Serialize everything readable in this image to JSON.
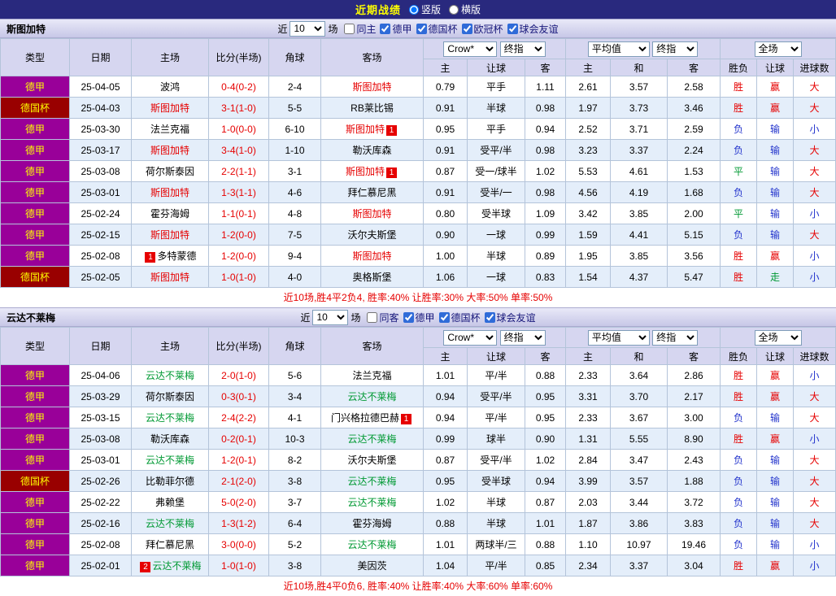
{
  "header": {
    "title": "近期战绩",
    "layout_options": [
      {
        "label": "竖版",
        "selected": true
      },
      {
        "label": "横版",
        "selected": false
      }
    ]
  },
  "colors": {
    "win": "#e60000",
    "draw": "#009933",
    "lose": "#2233cc",
    "score": "#e60000",
    "focus_team_section1": "#e60000",
    "focus_team_section2": "#009933",
    "league_dejia_bg": "#990099",
    "league_deguobei_bg": "#990000",
    "league_text": "#ffff00",
    "card_badge_bg": "#e60000"
  },
  "result_color_class": {
    "胜": "win",
    "平": "draw",
    "负": "lose",
    "赢": "win",
    "走": "draw",
    "输": "lose",
    "大": "win",
    "小": "lose"
  },
  "sections": [
    {
      "team": "斯图加特",
      "focus_color_key": "focus_team_section1",
      "filter": {
        "prefix": "近",
        "count": "10",
        "suffix": "场",
        "checkboxes": [
          {
            "label": "同主",
            "checked": false
          },
          {
            "label": "德甲",
            "checked": true
          },
          {
            "label": "德国杯",
            "checked": true
          },
          {
            "label": "欧冠杯",
            "checked": true
          },
          {
            "label": "球会友谊",
            "checked": true
          }
        ]
      },
      "table": {
        "static_headers": [
          "类型",
          "日期",
          "主场",
          "比分(半场)",
          "角球",
          "客场"
        ],
        "bookmaker_select": "Crow*",
        "bookmaker_odds_select": "终指",
        "avg_select": "平均值",
        "avg_odds_select": "终指",
        "scope_select": "全场",
        "odds_subheaders": [
          "主",
          "让球",
          "客"
        ],
        "avg_subheaders": [
          "主",
          "和",
          "客"
        ],
        "result_subheaders": [
          "胜负",
          "让球",
          "进球数"
        ],
        "rows": [
          {
            "league": "德甲",
            "date": "25-04-05",
            "home": "波鸿",
            "home_focus": false,
            "home_card": "",
            "score": "0-4(0-2)",
            "corner": "2-4",
            "away": "斯图加特",
            "away_focus": true,
            "away_card": "",
            "o1": "0.79",
            "hc": "平手",
            "o2": "1.11",
            "a1": "2.61",
            "a2": "3.57",
            "a3": "2.58",
            "res": "胜",
            "hres": "赢",
            "goal": "大"
          },
          {
            "league": "德国杯",
            "date": "25-04-03",
            "home": "斯图加特",
            "home_focus": true,
            "home_card": "",
            "score": "3-1(1-0)",
            "corner": "5-5",
            "away": "RB莱比锡",
            "away_focus": false,
            "away_card": "",
            "o1": "0.91",
            "hc": "半球",
            "o2": "0.98",
            "a1": "1.97",
            "a2": "3.73",
            "a3": "3.46",
            "res": "胜",
            "hres": "赢",
            "goal": "大"
          },
          {
            "league": "德甲",
            "date": "25-03-30",
            "home": "法兰克福",
            "home_focus": false,
            "home_card": "",
            "score": "1-0(0-0)",
            "corner": "6-10",
            "away": "斯图加特",
            "away_focus": true,
            "away_card": "1",
            "o1": "0.95",
            "hc": "平手",
            "o2": "0.94",
            "a1": "2.52",
            "a2": "3.71",
            "a3": "2.59",
            "res": "负",
            "hres": "输",
            "goal": "小"
          },
          {
            "league": "德甲",
            "date": "25-03-17",
            "home": "斯图加特",
            "home_focus": true,
            "home_card": "",
            "score": "3-4(1-0)",
            "corner": "1-10",
            "away": "勒沃库森",
            "away_focus": false,
            "away_card": "",
            "o1": "0.91",
            "hc": "受平/半",
            "o2": "0.98",
            "a1": "3.23",
            "a2": "3.37",
            "a3": "2.24",
            "res": "负",
            "hres": "输",
            "goal": "大"
          },
          {
            "league": "德甲",
            "date": "25-03-08",
            "home": "荷尔斯泰因",
            "home_focus": false,
            "home_card": "",
            "score": "2-2(1-1)",
            "corner": "3-1",
            "away": "斯图加特",
            "away_focus": true,
            "away_card": "1",
            "o1": "0.87",
            "hc": "受一/球半",
            "o2": "1.02",
            "a1": "5.53",
            "a2": "4.61",
            "a3": "1.53",
            "res": "平",
            "hres": "输",
            "goal": "大"
          },
          {
            "league": "德甲",
            "date": "25-03-01",
            "home": "斯图加特",
            "home_focus": true,
            "home_card": "",
            "score": "1-3(1-1)",
            "corner": "4-6",
            "away": "拜仁慕尼黑",
            "away_focus": false,
            "away_card": "",
            "o1": "0.91",
            "hc": "受半/一",
            "o2": "0.98",
            "a1": "4.56",
            "a2": "4.19",
            "a3": "1.68",
            "res": "负",
            "hres": "输",
            "goal": "大"
          },
          {
            "league": "德甲",
            "date": "25-02-24",
            "home": "霍芬海姆",
            "home_focus": false,
            "home_card": "",
            "score": "1-1(0-1)",
            "corner": "4-8",
            "away": "斯图加特",
            "away_focus": true,
            "away_card": "",
            "o1": "0.80",
            "hc": "受半球",
            "o2": "1.09",
            "a1": "3.42",
            "a2": "3.85",
            "a3": "2.00",
            "res": "平",
            "hres": "输",
            "goal": "小"
          },
          {
            "league": "德甲",
            "date": "25-02-15",
            "home": "斯图加特",
            "home_focus": true,
            "home_card": "",
            "score": "1-2(0-0)",
            "corner": "7-5",
            "away": "沃尔夫斯堡",
            "away_focus": false,
            "away_card": "",
            "o1": "0.90",
            "hc": "一球",
            "o2": "0.99",
            "a1": "1.59",
            "a2": "4.41",
            "a3": "5.15",
            "res": "负",
            "hres": "输",
            "goal": "大"
          },
          {
            "league": "德甲",
            "date": "25-02-08",
            "home": "多特蒙德",
            "home_focus": false,
            "home_card": "1",
            "score": "1-2(0-0)",
            "corner": "9-4",
            "away": "斯图加特",
            "away_focus": true,
            "away_card": "",
            "o1": "1.00",
            "hc": "半球",
            "o2": "0.89",
            "a1": "1.95",
            "a2": "3.85",
            "a3": "3.56",
            "res": "胜",
            "hres": "赢",
            "goal": "小"
          },
          {
            "league": "德国杯",
            "date": "25-02-05",
            "home": "斯图加特",
            "home_focus": true,
            "home_card": "",
            "score": "1-0(1-0)",
            "corner": "4-0",
            "away": "奥格斯堡",
            "away_focus": false,
            "away_card": "",
            "o1": "1.06",
            "hc": "一球",
            "o2": "0.83",
            "a1": "1.54",
            "a2": "4.37",
            "a3": "5.47",
            "res": "胜",
            "hres": "走",
            "goal": "小"
          }
        ]
      },
      "summary": "近10场,胜4平2负4, 胜率:40% 让胜率:30% 大率:50% 单率:50%"
    },
    {
      "team": "云达不莱梅",
      "focus_color_key": "focus_team_section2",
      "filter": {
        "prefix": "近",
        "count": "10",
        "suffix": "场",
        "checkboxes": [
          {
            "label": "同客",
            "checked": false
          },
          {
            "label": "德甲",
            "checked": true
          },
          {
            "label": "德国杯",
            "checked": true
          },
          {
            "label": "球会友谊",
            "checked": true
          }
        ]
      },
      "table": {
        "static_headers": [
          "类型",
          "日期",
          "主场",
          "比分(半场)",
          "角球",
          "客场"
        ],
        "bookmaker_select": "Crow*",
        "bookmaker_odds_select": "终指",
        "avg_select": "平均值",
        "avg_odds_select": "终指",
        "scope_select": "全场",
        "odds_subheaders": [
          "主",
          "让球",
          "客"
        ],
        "avg_subheaders": [
          "主",
          "和",
          "客"
        ],
        "result_subheaders": [
          "胜负",
          "让球",
          "进球数"
        ],
        "rows": [
          {
            "league": "德甲",
            "date": "25-04-06",
            "home": "云达不莱梅",
            "home_focus": true,
            "home_card": "",
            "score": "2-0(1-0)",
            "corner": "5-6",
            "away": "法兰克福",
            "away_focus": false,
            "away_card": "",
            "o1": "1.01",
            "hc": "平/半",
            "o2": "0.88",
            "a1": "2.33",
            "a2": "3.64",
            "a3": "2.86",
            "res": "胜",
            "hres": "赢",
            "goal": "小"
          },
          {
            "league": "德甲",
            "date": "25-03-29",
            "home": "荷尔斯泰因",
            "home_focus": false,
            "home_card": "",
            "score": "0-3(0-1)",
            "corner": "3-4",
            "away": "云达不莱梅",
            "away_focus": true,
            "away_card": "",
            "o1": "0.94",
            "hc": "受平/半",
            "o2": "0.95",
            "a1": "3.31",
            "a2": "3.70",
            "a3": "2.17",
            "res": "胜",
            "hres": "赢",
            "goal": "大"
          },
          {
            "league": "德甲",
            "date": "25-03-15",
            "home": "云达不莱梅",
            "home_focus": true,
            "home_card": "",
            "score": "2-4(2-2)",
            "corner": "4-1",
            "away": "门兴格拉德巴赫",
            "away_focus": false,
            "away_card": "1",
            "o1": "0.94",
            "hc": "平/半",
            "o2": "0.95",
            "a1": "2.33",
            "a2": "3.67",
            "a3": "3.00",
            "res": "负",
            "hres": "输",
            "goal": "大"
          },
          {
            "league": "德甲",
            "date": "25-03-08",
            "home": "勒沃库森",
            "home_focus": false,
            "home_card": "",
            "score": "0-2(0-1)",
            "corner": "10-3",
            "away": "云达不莱梅",
            "away_focus": true,
            "away_card": "",
            "o1": "0.99",
            "hc": "球半",
            "o2": "0.90",
            "a1": "1.31",
            "a2": "5.55",
            "a3": "8.90",
            "res": "胜",
            "hres": "赢",
            "goal": "小"
          },
          {
            "league": "德甲",
            "date": "25-03-01",
            "home": "云达不莱梅",
            "home_focus": true,
            "home_card": "",
            "score": "1-2(0-1)",
            "corner": "8-2",
            "away": "沃尔夫斯堡",
            "away_focus": false,
            "away_card": "",
            "o1": "0.87",
            "hc": "受平/半",
            "o2": "1.02",
            "a1": "2.84",
            "a2": "3.47",
            "a3": "2.43",
            "res": "负",
            "hres": "输",
            "goal": "大"
          },
          {
            "league": "德国杯",
            "date": "25-02-26",
            "home": "比勒菲尔德",
            "home_focus": false,
            "home_card": "",
            "score": "2-1(2-0)",
            "corner": "3-8",
            "away": "云达不莱梅",
            "away_focus": true,
            "away_card": "",
            "o1": "0.95",
            "hc": "受半球",
            "o2": "0.94",
            "a1": "3.99",
            "a2": "3.57",
            "a3": "1.88",
            "res": "负",
            "hres": "输",
            "goal": "大"
          },
          {
            "league": "德甲",
            "date": "25-02-22",
            "home": "弗赖堡",
            "home_focus": false,
            "home_card": "",
            "score": "5-0(2-0)",
            "corner": "3-7",
            "away": "云达不莱梅",
            "away_focus": true,
            "away_card": "",
            "o1": "1.02",
            "hc": "半球",
            "o2": "0.87",
            "a1": "2.03",
            "a2": "3.44",
            "a3": "3.72",
            "res": "负",
            "hres": "输",
            "goal": "大"
          },
          {
            "league": "德甲",
            "date": "25-02-16",
            "home": "云达不莱梅",
            "home_focus": true,
            "home_card": "",
            "score": "1-3(1-2)",
            "corner": "6-4",
            "away": "霍芬海姆",
            "away_focus": false,
            "away_card": "",
            "o1": "0.88",
            "hc": "半球",
            "o2": "1.01",
            "a1": "1.87",
            "a2": "3.86",
            "a3": "3.83",
            "res": "负",
            "hres": "输",
            "goal": "大"
          },
          {
            "league": "德甲",
            "date": "25-02-08",
            "home": "拜仁慕尼黑",
            "home_focus": false,
            "home_card": "",
            "score": "3-0(0-0)",
            "corner": "5-2",
            "away": "云达不莱梅",
            "away_focus": true,
            "away_card": "",
            "o1": "1.01",
            "hc": "两球半/三",
            "o2": "0.88",
            "a1": "1.10",
            "a2": "10.97",
            "a3": "19.46",
            "res": "负",
            "hres": "输",
            "goal": "小"
          },
          {
            "league": "德甲",
            "date": "25-02-01",
            "home": "云达不莱梅",
            "home_focus": true,
            "home_card": "2",
            "score": "1-0(1-0)",
            "corner": "3-8",
            "away": "美因茨",
            "away_focus": false,
            "away_card": "",
            "o1": "1.04",
            "hc": "平/半",
            "o2": "0.85",
            "a1": "2.34",
            "a2": "3.37",
            "a3": "3.04",
            "res": "胜",
            "hres": "赢",
            "goal": "小"
          }
        ]
      },
      "summary": "近10场,胜4平0负6, 胜率:40% 让胜率:40% 大率:60% 单率:60%"
    }
  ]
}
